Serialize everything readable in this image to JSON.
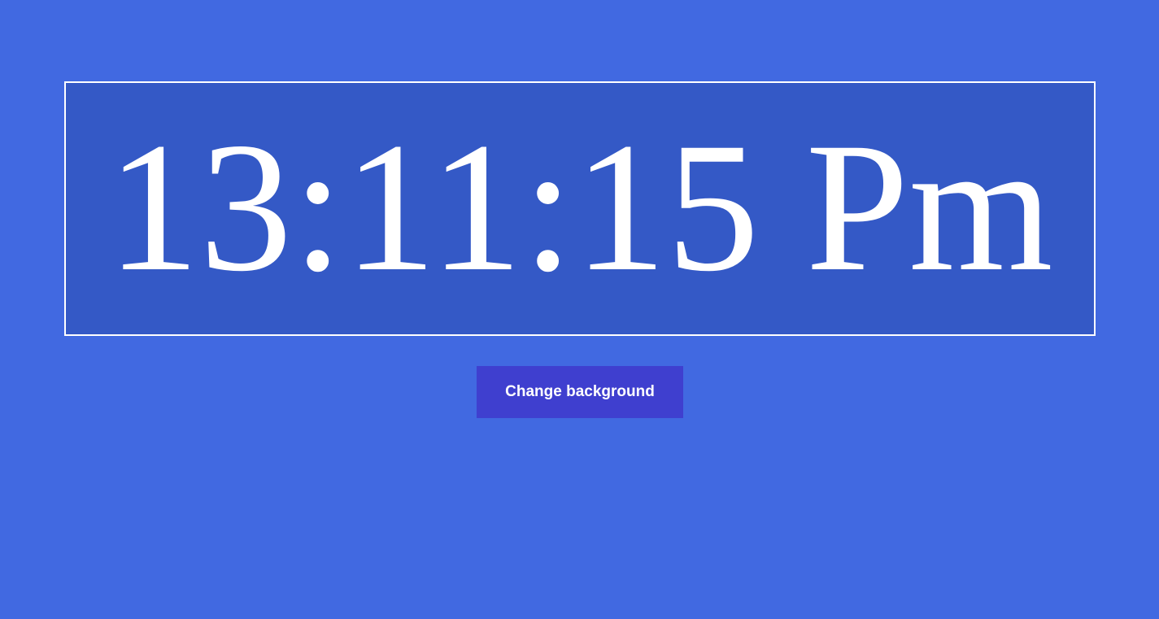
{
  "clock": {
    "time": "13:11:15 Pm"
  },
  "controls": {
    "change_background_label": "Change background"
  },
  "colors": {
    "page_background": "#4169e1",
    "clock_background": "#3459c6",
    "clock_border": "#ffffff",
    "button_background": "#3f3fcf",
    "text": "#ffffff"
  }
}
